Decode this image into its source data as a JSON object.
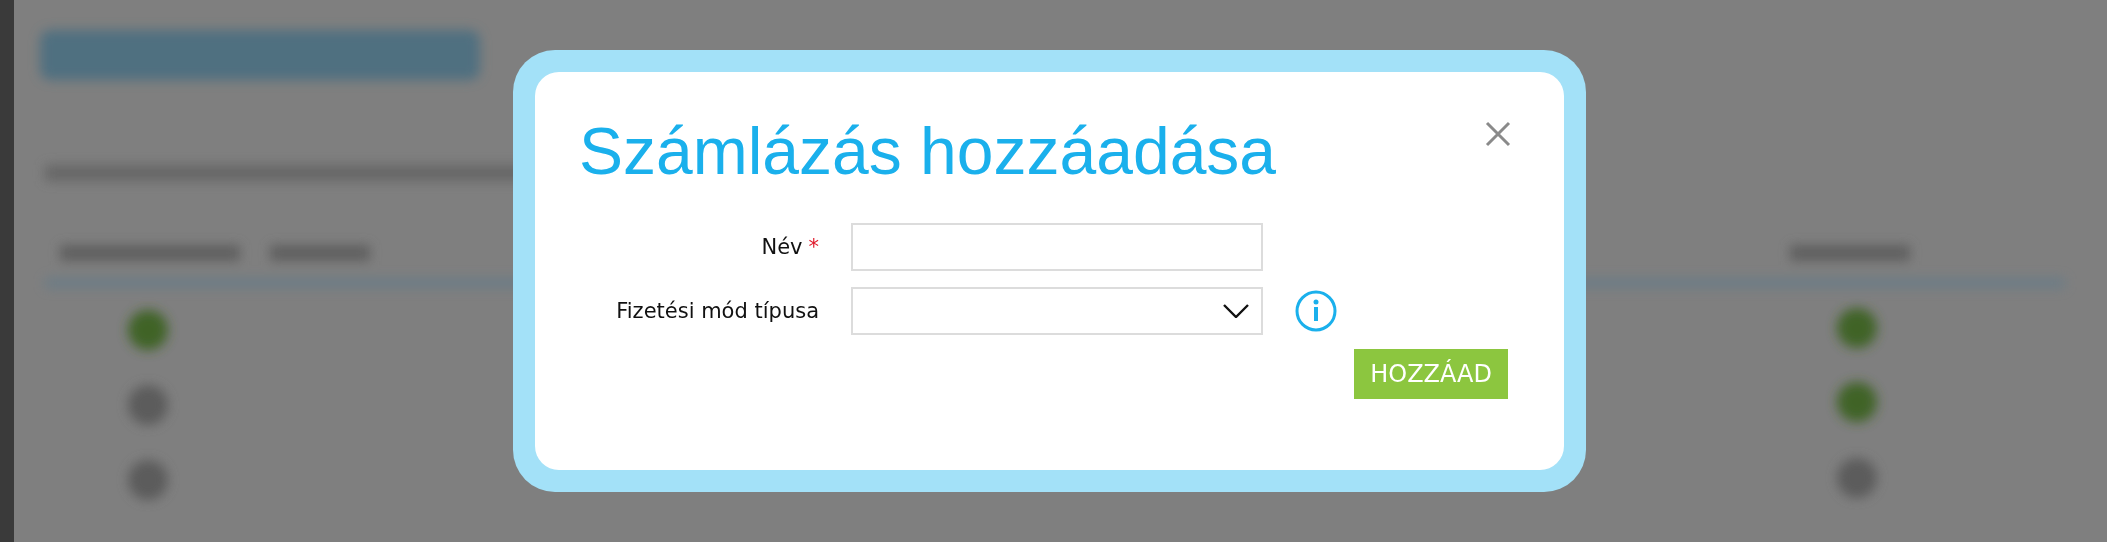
{
  "dialog": {
    "title": "Számlázás hozzáadása",
    "fields": [
      {
        "kind": "text",
        "label": "Név",
        "required_mark": "*"
      },
      {
        "kind": "select",
        "label": "Fizetési mód típusa",
        "info": true
      }
    ],
    "submit": "HOZZÁAD"
  }
}
